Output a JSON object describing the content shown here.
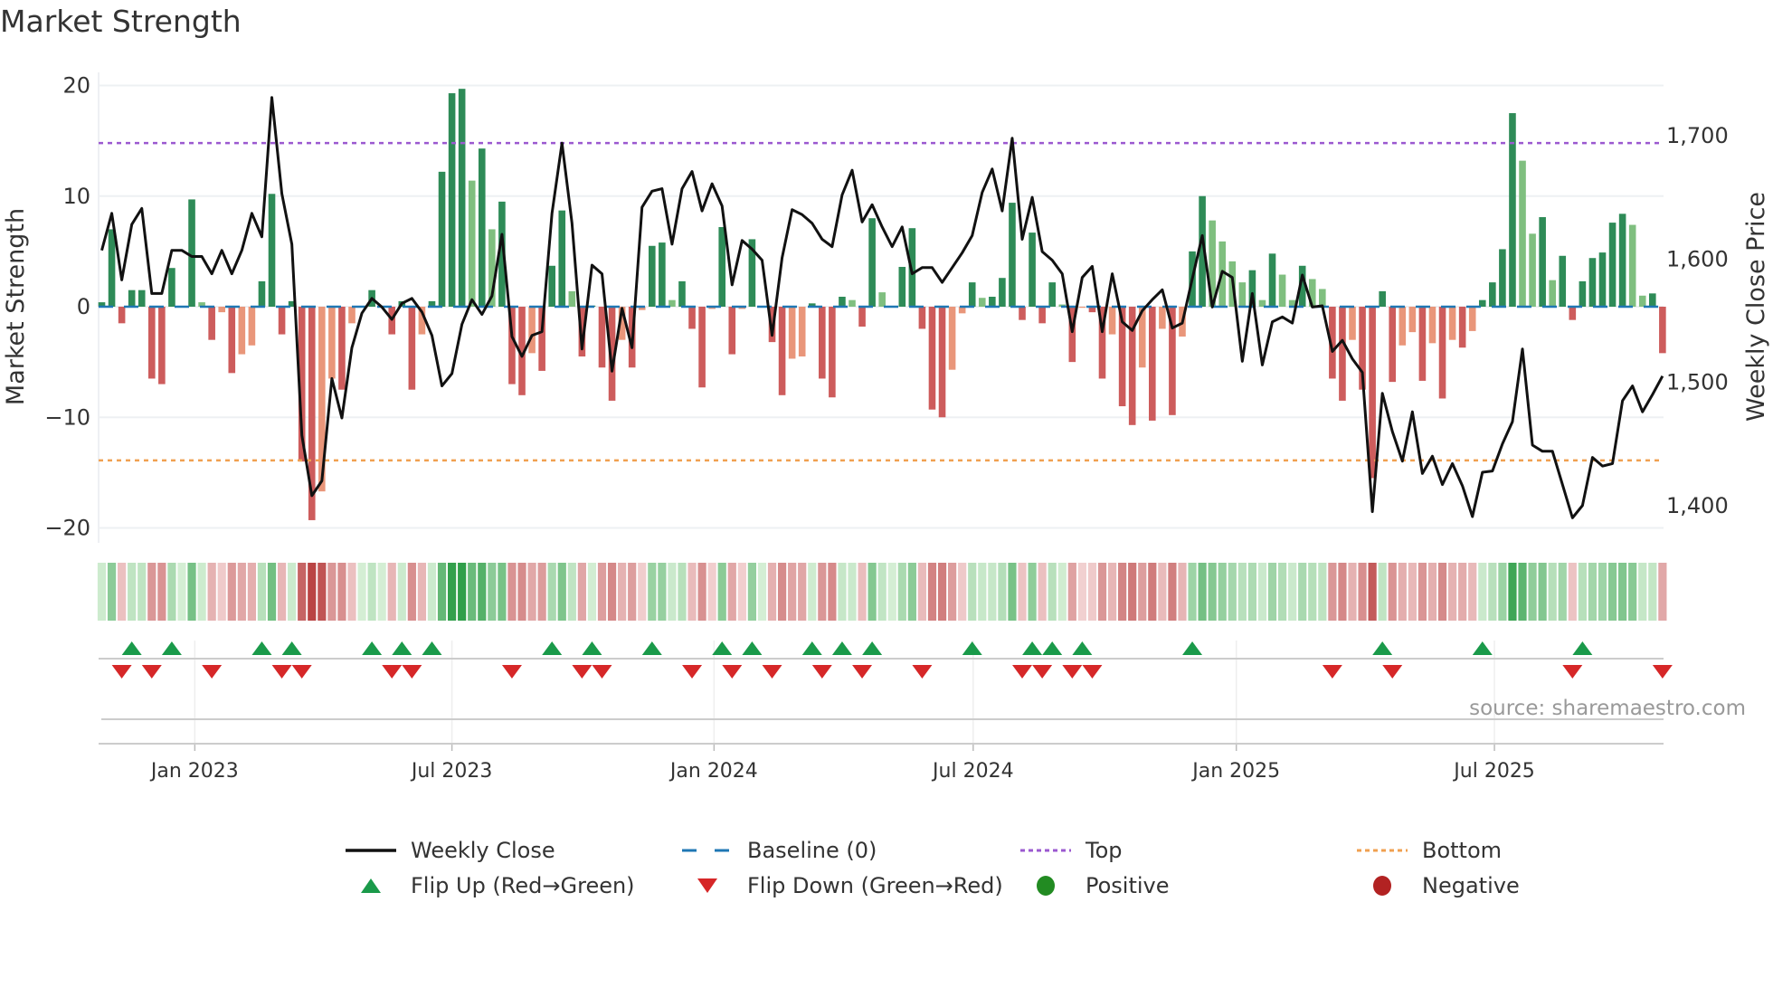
{
  "title": "Market Strength",
  "source": "source: sharemaestro.com",
  "chart_data": {
    "type": "bar",
    "title": "Market Strength",
    "ylabel": "Market Strength",
    "y2label": "Weekly Close Price",
    "ylim": [
      -21,
      21
    ],
    "y2lim": [
      1380,
      1740
    ],
    "yticks": [
      {
        "v": 20,
        "label": "20"
      },
      {
        "v": 10,
        "label": "10"
      },
      {
        "v": 0,
        "label": "0"
      },
      {
        "v": -10,
        "label": "−10"
      },
      {
        "v": -20,
        "label": "−20"
      }
    ],
    "y2ticks": [
      {
        "v": 1700,
        "label": "1,700"
      },
      {
        "v": 1600,
        "label": "1,600"
      },
      {
        "v": 1500,
        "label": "1,500"
      },
      {
        "v": 1400,
        "label": "1,400"
      }
    ],
    "xticks": [
      {
        "week": 9.3,
        "label": "Jan 2023"
      },
      {
        "week": 35,
        "label": "Jul 2023"
      },
      {
        "week": 61.2,
        "label": "Jan 2024"
      },
      {
        "week": 87.1,
        "label": "Jul 2024"
      },
      {
        "week": 113.4,
        "label": "Jan 2025"
      },
      {
        "week": 139.2,
        "label": "Jul 2025"
      }
    ],
    "top_level": 14.8,
    "bottom_level": -13.9,
    "baseline": 0,
    "strength": [
      0.4,
      7,
      -1.5,
      1.5,
      1.5,
      -6.5,
      -7,
      3.5,
      0,
      9.7,
      0.4,
      -3,
      -0.5,
      -6,
      -4.3,
      -3.5,
      2.3,
      10.2,
      -2.5,
      0.5,
      -14,
      -19.3,
      -16.7,
      -6.5,
      -7.5,
      -1.5,
      0,
      1.5,
      0,
      -2.5,
      0.5,
      -7.5,
      -2.5,
      0.5,
      12.2,
      19.3,
      19.7,
      11.4,
      14.3,
      7,
      9.5,
      -7,
      -8,
      -4.2,
      -5.8,
      3.7,
      8.7,
      1.4,
      -4.5,
      0.1,
      -5.5,
      -8.5,
      -3,
      -5.5,
      -0.3,
      5.5,
      5.8,
      0.6,
      2.3,
      -2,
      -7.3,
      -0.2,
      7.2,
      -4.3,
      -0.2,
      6.1,
      0,
      -3.2,
      -8,
      -4.7,
      -4.5,
      0.3,
      -6.5,
      -8.2,
      0.9,
      0.6,
      -1.8,
      8,
      1.3,
      0,
      3.6,
      7.1,
      -2,
      -9.3,
      -10,
      -5.7,
      -0.6,
      2.2,
      0.8,
      0.9,
      2.6,
      9.4,
      -1.2,
      6.7,
      -1.5,
      2.2,
      0.2,
      -5,
      -0.1,
      -0.5,
      -6.5,
      -2.5,
      -9,
      -10.7,
      -5.5,
      -10.3,
      -2,
      -9.8,
      -2.7,
      5,
      10,
      7.8,
      5.9,
      4.1,
      2.2,
      3.3,
      0.6,
      4.8,
      2.9,
      0.6,
      3.7,
      2.5,
      1.6,
      -6.5,
      -8.5,
      -3,
      -7.5,
      -15.5,
      1.4,
      -6.8,
      -3.5,
      -2.3,
      -6.7,
      -3.3,
      -8.3,
      -3,
      -3.7,
      -2.2,
      0.6,
      2.2,
      5.2,
      17.5,
      13.2,
      6.6,
      8.1,
      2.4,
      4.6,
      -1.2,
      2.3,
      4.4,
      4.9,
      7.6,
      8.4,
      7.4,
      1,
      1.2,
      -4.2
    ],
    "tone": "GGRGGRRGGGgRrRrrGGRGRRrrRrGGGRGRrGGGGgGgGRRrRGGgRGRRrRrGGgGRRrGRrGGRRrrGRRGgRGgGGGRRRrrGgGGGRGRGgRrRRrRRrRrRrGGggggGgGggGggRRrRRGRrrRrRrRrGGGGggGgGRGGGGGggGR",
    "weekly_close": [
      1607,
      1637,
      1583,
      1628,
      1641,
      1572,
      1572,
      1607,
      1607,
      1602,
      1602,
      1588,
      1607,
      1588,
      1607,
      1637,
      1618,
      1731,
      1653,
      1612,
      1457,
      1408,
      1420,
      1503,
      1471,
      1528,
      1556,
      1568,
      1561,
      1551,
      1564,
      1568,
      1557,
      1538,
      1497,
      1507,
      1547,
      1567,
      1555,
      1570,
      1620,
      1537,
      1521,
      1538,
      1541,
      1637,
      1694,
      1629,
      1527,
      1595,
      1588,
      1509,
      1560,
      1528,
      1642,
      1655,
      1657,
      1612,
      1657,
      1671,
      1639,
      1661,
      1643,
      1579,
      1615,
      1608,
      1599,
      1538,
      1601,
      1640,
      1636,
      1629,
      1616,
      1610,
      1652,
      1672,
      1630,
      1644,
      1626,
      1610,
      1626,
      1588,
      1593,
      1593,
      1581,
      1593,
      1605,
      1619,
      1654,
      1673,
      1639,
      1698,
      1616,
      1650,
      1606,
      1599,
      1588,
      1541,
      1585,
      1594,
      1541,
      1588,
      1549,
      1542,
      1558,
      1567,
      1575,
      1544,
      1548,
      1584,
      1619,
      1561,
      1590,
      1585,
      1517,
      1572,
      1514,
      1549,
      1553,
      1548,
      1587,
      1561,
      1562,
      1525,
      1534,
      1519,
      1508,
      1395,
      1491,
      1460,
      1436,
      1476,
      1426,
      1440,
      1417,
      1434,
      1416,
      1391,
      1427,
      1428,
      1450,
      1468,
      1527,
      1449,
      1444,
      1444,
      1417,
      1390,
      1400,
      1439,
      1432,
      1434,
      1485,
      1497,
      1476,
      1490,
      1505
    ],
    "flip_up_weeks": [
      3,
      7,
      16,
      19,
      27,
      30,
      33,
      45,
      49,
      55,
      62,
      65,
      71,
      74,
      77,
      87,
      93,
      95,
      98,
      109,
      128,
      138,
      148
    ],
    "flip_down_weeks": [
      2,
      5,
      11,
      18,
      20,
      29,
      31,
      41,
      48,
      50,
      59,
      63,
      67,
      72,
      76,
      82,
      92,
      94,
      97,
      99,
      123,
      129,
      147,
      156
    ],
    "colors": {
      "G": "#2e8b57",
      "g": "#7fbf7f",
      "R": "#cd5c5c",
      "r": "#e9967a",
      "close": "#111111",
      "baseline": "#1f77b4",
      "top": "#9b59d0",
      "bottom": "#f0a050",
      "up": "#1a9a4a",
      "down": "#d62728",
      "positive": "#228b22",
      "negative": "#b22222"
    },
    "legend": [
      {
        "key": "close",
        "label": "Weekly Close"
      },
      {
        "key": "baseline",
        "label": "Baseline (0)"
      },
      {
        "key": "top",
        "label": "Top"
      },
      {
        "key": "bottom",
        "label": "Bottom"
      },
      {
        "key": "up",
        "label": "Flip Up (Red→Green)"
      },
      {
        "key": "down",
        "label": "Flip Down (Green→Red)"
      },
      {
        "key": "positive",
        "label": "Positive"
      },
      {
        "key": "negative",
        "label": "Negative"
      }
    ]
  }
}
